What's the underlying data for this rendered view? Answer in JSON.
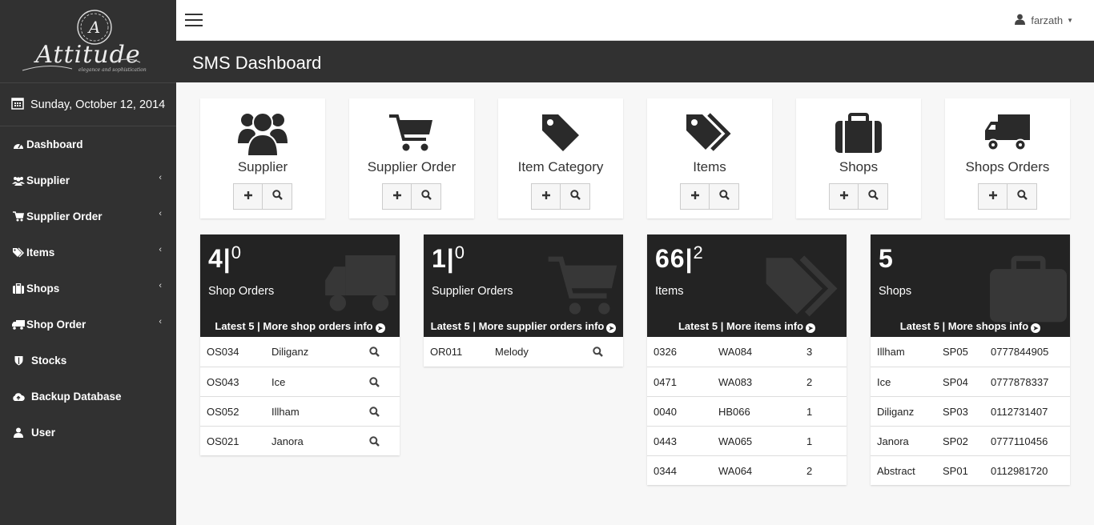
{
  "brand": {
    "name": "Attitude",
    "tagline": "elegance and sophistication"
  },
  "date": "Sunday, October 12, 2014",
  "nav": [
    {
      "label": "Dashboard",
      "icon": "dashboard-icon",
      "has_submenu": false
    },
    {
      "label": "Supplier",
      "icon": "users-icon",
      "has_submenu": true
    },
    {
      "label": "Supplier Order",
      "icon": "cart-icon",
      "has_submenu": true
    },
    {
      "label": "Items",
      "icon": "tags-icon",
      "has_submenu": true
    },
    {
      "label": "Shops",
      "icon": "briefcase-icon",
      "has_submenu": true
    },
    {
      "label": "Shop Order",
      "icon": "truck-icon",
      "has_submenu": true
    },
    {
      "label": "Stocks",
      "icon": "shield-icon",
      "has_submenu": false
    },
    {
      "label": "Backup Database",
      "icon": "cloud-upload-icon",
      "has_submenu": false
    },
    {
      "label": "User",
      "icon": "user-icon",
      "has_submenu": false
    }
  ],
  "topbar": {
    "username": "farzath"
  },
  "page": {
    "title": "SMS Dashboard"
  },
  "tiles": [
    {
      "label": "Supplier",
      "icon": "users-icon"
    },
    {
      "label": "Supplier Order",
      "icon": "cart-icon"
    },
    {
      "label": "Item Category",
      "icon": "tag-icon"
    },
    {
      "label": "Items",
      "icon": "tags-icon"
    },
    {
      "label": "Shops",
      "icon": "briefcase-icon"
    },
    {
      "label": "Shops Orders",
      "icon": "truck-icon"
    }
  ],
  "panels": {
    "shop_orders": {
      "count": "4|",
      "sup": "0",
      "title": "Shop Orders",
      "footer": "Latest 5 | More shop orders info",
      "rows": [
        {
          "id": "OS034",
          "name": "Diliganz"
        },
        {
          "id": "OS043",
          "name": "Ice"
        },
        {
          "id": "OS052",
          "name": "Illham"
        },
        {
          "id": "OS021",
          "name": "Janora"
        }
      ]
    },
    "supplier_orders": {
      "count": "1|",
      "sup": "0",
      "title": "Supplier Orders",
      "footer": "Latest 5 | More supplier orders info",
      "rows": [
        {
          "id": "OR011",
          "name": "Melody"
        }
      ]
    },
    "items": {
      "count": "66|",
      "sup": "2",
      "title": "Items",
      "footer": "Latest 5 | More items info",
      "rows": [
        {
          "id": "0326",
          "code": "WA084",
          "qty": "3"
        },
        {
          "id": "0471",
          "code": "WA083",
          "qty": "2"
        },
        {
          "id": "0040",
          "code": "HB066",
          "qty": "1"
        },
        {
          "id": "0443",
          "code": "WA065",
          "qty": "1"
        },
        {
          "id": "0344",
          "code": "WA064",
          "qty": "2"
        }
      ]
    },
    "shops": {
      "count": "5",
      "sup": "",
      "title": "Shops",
      "footer": "Latest 5 | More shops info",
      "rows": [
        {
          "name": "Illham",
          "code": "SP05",
          "phone": "0777844905"
        },
        {
          "name": "Ice",
          "code": "SP04",
          "phone": "0777878337"
        },
        {
          "name": "Diliganz",
          "code": "SP03",
          "phone": "0112731407"
        },
        {
          "name": "Janora",
          "code": "SP02",
          "phone": "0777110456"
        },
        {
          "name": "Abstract",
          "code": "SP01",
          "phone": "0112981720"
        }
      ]
    }
  },
  "colors": {
    "sidebar": "#313131",
    "header": "#313131",
    "panel_head": "#232323",
    "background": "#f7f7f7"
  }
}
